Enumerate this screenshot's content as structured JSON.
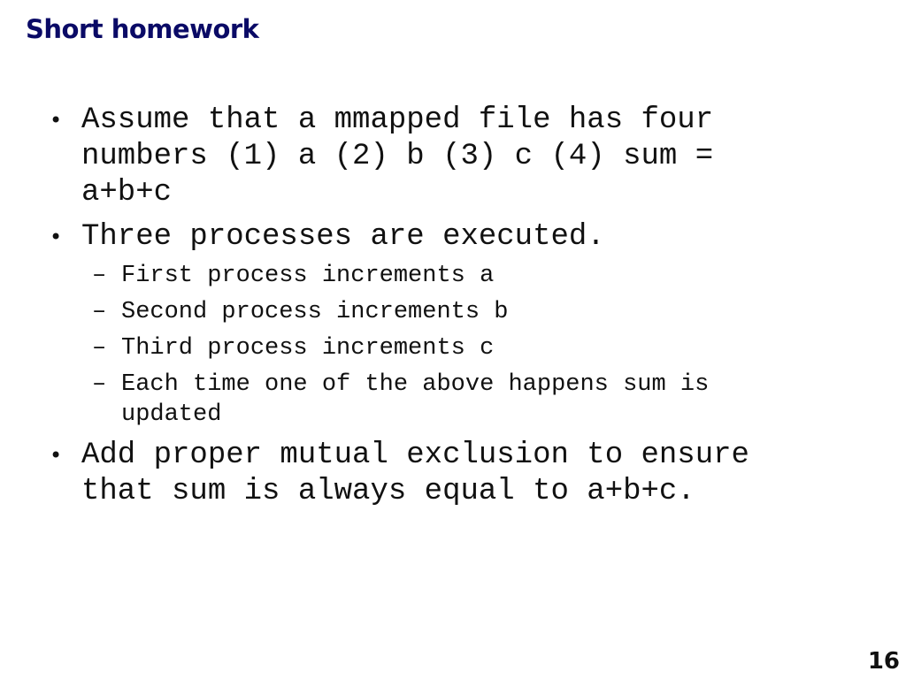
{
  "slide": {
    "title": "Short homework",
    "page_number": "16",
    "bullets": [
      {
        "symbol": "•",
        "lines": [
          "Assume that a mmapped file has four",
          "numbers (1) a (2) b (3) c (4) sum =",
          "a+b+c"
        ]
      },
      {
        "symbol": "•",
        "lines": [
          "Three processes are executed."
        ]
      },
      {
        "symbol": "•",
        "lines": [
          "Add proper mutual exclusion to ensure",
          "that sum is always equal to a+b+c."
        ]
      }
    ],
    "sub_bullets": [
      {
        "symbol": "–",
        "lines": [
          "First process increments a"
        ]
      },
      {
        "symbol": "–",
        "lines": [
          "Second process increments b"
        ]
      },
      {
        "symbol": "–",
        "lines": [
          "Third process increments c"
        ]
      },
      {
        "symbol": "–",
        "lines": [
          "Each time one of the above happens sum is",
          "updated"
        ]
      }
    ]
  }
}
